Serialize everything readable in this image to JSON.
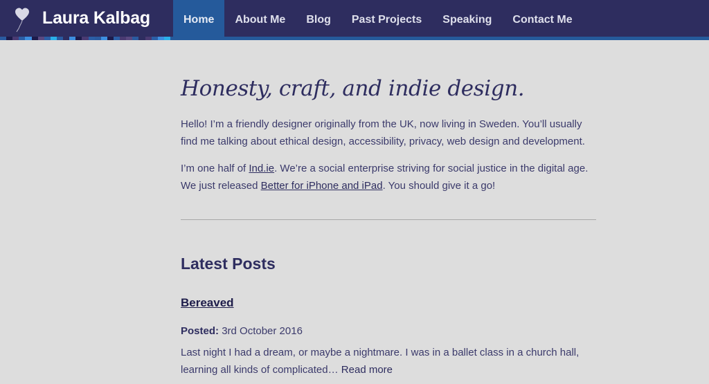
{
  "header": {
    "logo_icon": "heart-balloon-icon",
    "site_title": "Laura Kalbag",
    "colors": {
      "background": "#2e2d5f",
      "active_tab": "#255a9b"
    }
  },
  "nav": {
    "items": [
      {
        "label": "Home",
        "active": true
      },
      {
        "label": "About Me",
        "active": false
      },
      {
        "label": "Blog",
        "active": false
      },
      {
        "label": "Past Projects",
        "active": false
      },
      {
        "label": "Speaking",
        "active": false
      },
      {
        "label": "Contact Me",
        "active": false
      }
    ]
  },
  "main": {
    "tagline": "Honesty, craft, and indie design.",
    "intro": {
      "p1": "Hello! I’m a friendly designer originally from the UK, now living in Sweden. You’ll usually find me talking about ethical design, accessibility, privacy, web design and development.",
      "p2_before_link1": "I’m one half of ",
      "link1": "Ind.ie",
      "p2_between": ". We’re a social enterprise striving for social justice in the digital age. We just released ",
      "link2": "Better for iPhone and iPad",
      "p2_after": ". You should give it a go!"
    },
    "latest_posts": {
      "heading": "Latest Posts",
      "posts": [
        {
          "title": "Bereaved",
          "posted_label": "Posted:",
          "date": "3rd October 2016",
          "excerpt": "Last night I had a dream, or maybe a nightmare. I was in a ballet class in a church hall, learning all kinds of complicated… ",
          "read_more": "Read more"
        }
      ]
    }
  }
}
